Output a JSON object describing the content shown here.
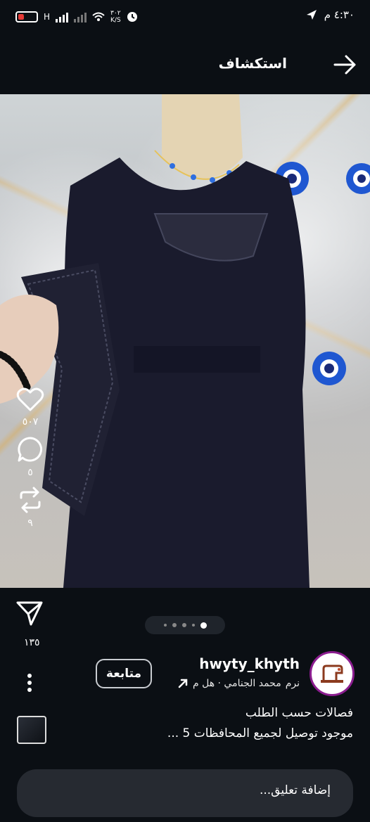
{
  "status_bar": {
    "battery": "١٨",
    "network_type": "H",
    "data_speed": "٣٠٢",
    "data_unit": "K/S",
    "time": "٤:٣٠ م"
  },
  "header": {
    "title": "استكشاف"
  },
  "post": {
    "likes": "٥٠٧",
    "comments": "٥",
    "reposts": "٩",
    "shares": "١٣٥",
    "pager": {
      "count": 5,
      "active_index": 4
    },
    "username": "hwyty_khyth",
    "follow_label": "متابعة",
    "meta": "محمد الجنامي · هل م",
    "meta_trailing": "نرم",
    "caption_line1": "فصالات حسب الطلب",
    "caption_line2": "موجود توصيل لجميع المحافظات 5 ..."
  },
  "comment_box": {
    "placeholder": "إضافة تعليق..."
  },
  "colors": {
    "background": "#0b0f14",
    "avatar_ring": "#8b1d8f"
  }
}
